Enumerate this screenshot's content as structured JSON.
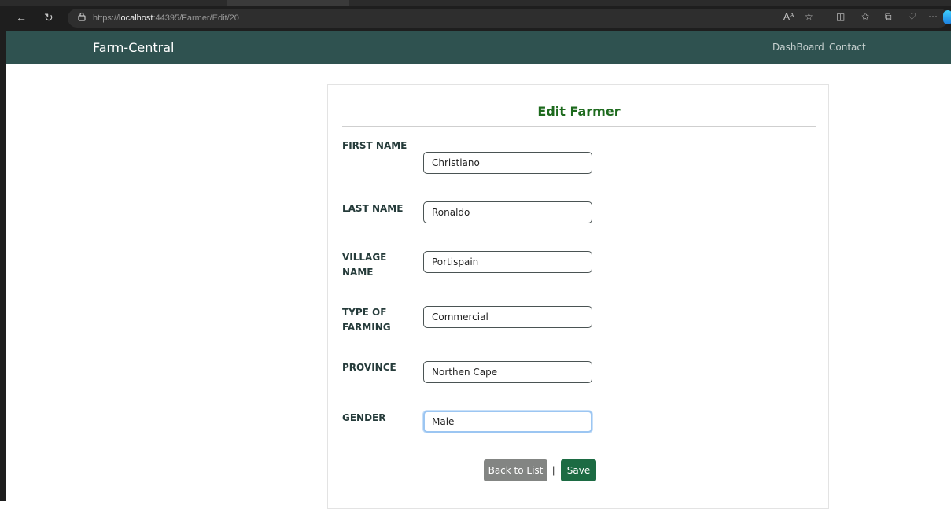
{
  "browser": {
    "url_prefix": "https://",
    "url_host": "localhost",
    "url_path": ":44395/Farmer/Edit/20"
  },
  "navbar": {
    "brand": "Farm-Central",
    "links": [
      "DashBoard",
      "Contact"
    ]
  },
  "form": {
    "title": "Edit Farmer",
    "fields": [
      {
        "label": "FIRST NAME",
        "value": "Christiano"
      },
      {
        "label": "LAST NAME",
        "value": "Ronaldo"
      },
      {
        "label": "VILLAGE NAME",
        "value": "Portispain"
      },
      {
        "label": "TYPE OF FARMING",
        "value": "Commercial"
      },
      {
        "label": "PROVINCE",
        "value": "Northen Cape"
      },
      {
        "label": "GENDER",
        "value": "Male"
      }
    ],
    "back_label": "Back to List",
    "separator": "|",
    "save_label": "Save"
  }
}
